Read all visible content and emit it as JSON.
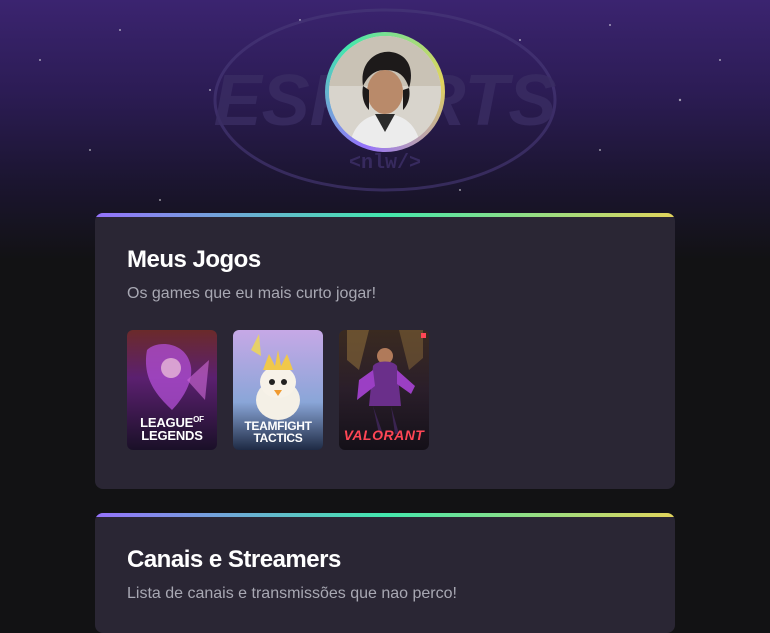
{
  "profile": {
    "avatar_alt": "Foto de perfil"
  },
  "games_card": {
    "title": "Meus Jogos",
    "subtitle": "Os games que eu mais curto jogar!",
    "games": [
      {
        "label_line1": "LEAGUE",
        "label_line1_suffix": "OF",
        "label_line2": "LEGENDS",
        "icon": "league-of-legends-cover"
      },
      {
        "label_line1": "TEAMFIGHT",
        "label_line2": "TACTICS",
        "icon": "teamfight-tactics-cover"
      },
      {
        "label_line1": "VALORANT",
        "icon": "valorant-cover"
      }
    ]
  },
  "channels_card": {
    "title": "Canais e Streamers",
    "subtitle": "Lista de canais e transmissões que nao perco!"
  },
  "colors": {
    "background": "#121214",
    "card": "#2a2634",
    "gradient_start": "#9572fc",
    "gradient_mid": "#43e7ad",
    "gradient_end": "#e2d45c",
    "muted_text": "#a8a8b3"
  }
}
